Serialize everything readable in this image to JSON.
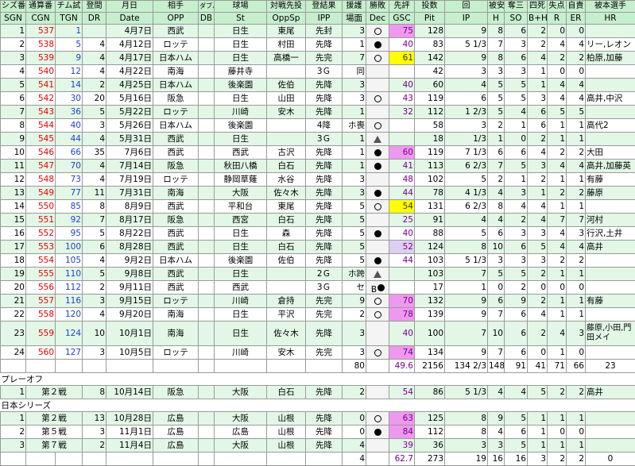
{
  "header_ja": [
    "シズ番",
    "通算番",
    "チム試",
    "登間",
    "月日",
    "相手",
    "ダブル",
    "球場",
    "対戦先投",
    "登結果",
    "援護",
    "勝敗",
    "先評",
    "投数",
    "回",
    "被安",
    "奪三",
    "四死",
    "失点",
    "自責",
    "被本選手"
  ],
  "header_en": [
    "SGN",
    "CGN",
    "TGN",
    "DR",
    "Date",
    "OPP",
    "DB",
    "St",
    "OppSp",
    "IPP",
    "場面",
    "Dec",
    "GSC",
    "Pit",
    "IP",
    "H",
    "SO",
    "B+H",
    "R",
    "ER",
    "HR"
  ],
  "regular_rows": [
    {
      "sgn": "1",
      "cgn": "537",
      "tgn": "1",
      "dr": "",
      "date": "4月7日",
      "opp": "西武",
      "db": "",
      "st": "日生",
      "oppsp": "東尾",
      "ipp": "先封",
      "ba": "3",
      "dec": "lose",
      "gsc": "75",
      "gsc_style": "pk",
      "pit": "128",
      "ip": "9",
      "h": "8",
      "so": "6",
      "bb": "2",
      "r": "0",
      "er": "0",
      "hr": ""
    },
    {
      "sgn": "2",
      "cgn": "538",
      "tgn": "5",
      "dr": "4",
      "date": "4月12日",
      "opp": "ロッテ",
      "db": "",
      "st": "日生",
      "oppsp": "村田",
      "ipp": "先降",
      "ba": "1",
      "dec": "win",
      "gsc": "40",
      "gsc_style": "",
      "pit": "83",
      "ip": "5 1/3",
      "h": "7",
      "so": "3",
      "bb": "2",
      "r": "4",
      "er": "4",
      "hr": "リー,レオン"
    },
    {
      "sgn": "3",
      "cgn": "539",
      "tgn": "9",
      "dr": "4",
      "date": "4月17日",
      "opp": "日本ハム",
      "db": "",
      "st": "日生",
      "oppsp": "高橋一",
      "ipp": "先完",
      "ba": "7",
      "dec": "lose",
      "gsc": "61",
      "gsc_style": "yl",
      "pit": "142",
      "ip": "9",
      "h": "8",
      "so": "6",
      "bb": "4",
      "r": "2",
      "er": "2",
      "hr": "柏原,加藤"
    },
    {
      "sgn": "4",
      "cgn": "540",
      "tgn": "12",
      "dr": "4",
      "date": "4月22日",
      "opp": "南海",
      "db": "",
      "st": "藤井寺",
      "oppsp": "",
      "ipp": "3Ｇ",
      "ba": "同",
      "dec": "",
      "gsc": "",
      "gsc_style": "",
      "pit": "42",
      "ip": "3",
      "h": "3",
      "so": "3",
      "bb": "1",
      "r": "0",
      "er": "0",
      "hr": ""
    },
    {
      "sgn": "5",
      "cgn": "541",
      "tgn": "14",
      "dr": "2",
      "date": "4月25日",
      "opp": "日本ハム",
      "db": "",
      "st": "後楽園",
      "oppsp": "佐伯",
      "ipp": "先降",
      "ba": "3",
      "dec": "",
      "gsc": "40",
      "gsc_style": "",
      "pit": "60",
      "ip": "4",
      "h": "5",
      "so": "5",
      "bb": "1",
      "r": "4",
      "er": "4",
      "hr": ""
    },
    {
      "sgn": "6",
      "cgn": "542",
      "tgn": "30",
      "dr": "20",
      "date": "5月16日",
      "opp": "阪急",
      "db": "",
      "st": "日生",
      "oppsp": "山田",
      "ipp": "先降",
      "ba": "3",
      "dec": "lose",
      "gsc": "43",
      "gsc_style": "",
      "pit": "119",
      "ip": "6",
      "h": "5",
      "so": "5",
      "bb": "3",
      "r": "4",
      "er": "4",
      "hr": "高井,中沢"
    },
    {
      "sgn": "7",
      "cgn": "543",
      "tgn": "36",
      "dr": "5",
      "date": "5月22日",
      "opp": "ロッテ",
      "db": "",
      "st": "川崎",
      "oppsp": "安木",
      "ipp": "先降",
      "ba": "1",
      "dec": "",
      "gsc": "32",
      "gsc_style": "",
      "pit": "112",
      "ip": "1 2/3",
      "h": "5",
      "so": "4",
      "bb": "6",
      "r": "5",
      "er": "5",
      "hr": ""
    },
    {
      "sgn": "8",
      "cgn": "544",
      "tgn": "40",
      "dr": "3",
      "date": "5月26日",
      "opp": "日本ハム",
      "db": "",
      "st": "後楽園",
      "oppsp": "",
      "ipp": "4降",
      "ba": "ホ喪",
      "dec": "lose",
      "gsc": "",
      "gsc_style": "",
      "pit": "58",
      "ip": "3",
      "h": "2",
      "so": "1",
      "bb": "6",
      "r": "1",
      "er": "1",
      "hr": "高代2"
    },
    {
      "sgn": "9",
      "cgn": "545",
      "tgn": "44",
      "dr": "4",
      "date": "5月31日",
      "opp": "西武",
      "db": "",
      "st": "日生",
      "oppsp": "",
      "ipp": "3Ｇ",
      "ba": "1",
      "dec": "tri",
      "gsc": "",
      "gsc_style": "",
      "pit": "18",
      "ip": "1/3",
      "h": "1",
      "so": "0",
      "bb": "2",
      "r": "1",
      "er": "1",
      "hr": ""
    },
    {
      "sgn": "10",
      "cgn": "546",
      "tgn": "66",
      "dr": "35",
      "date": "7月6日",
      "opp": "西武",
      "db": "",
      "st": "西武",
      "oppsp": "古沢",
      "ipp": "先降",
      "ba": "1",
      "dec": "win",
      "gsc": "60",
      "gsc_style": "pk",
      "pit": "119",
      "ip": "7 1/3",
      "h": "6",
      "so": "6",
      "bb": "4",
      "r": "2",
      "er": "2",
      "hr": "大田"
    },
    {
      "sgn": "11",
      "cgn": "547",
      "tgn": "70",
      "dr": "4",
      "date": "7月14日",
      "opp": "阪急",
      "db": "",
      "st": "秋田八橋",
      "oppsp": "白石",
      "ipp": "先降",
      "ba": "1",
      "dec": "win",
      "gsc": "41",
      "gsc_style": "",
      "pit": "113",
      "ip": "6 2/3",
      "h": "7",
      "so": "5",
      "bb": "3",
      "r": "4",
      "er": "4",
      "hr": "高井,加藤英"
    },
    {
      "sgn": "12",
      "cgn": "548",
      "tgn": "73",
      "dr": "4",
      "date": "7月19日",
      "opp": "ロッテ",
      "db": "",
      "st": "静岡草薙",
      "oppsp": "水谷",
      "ipp": "先降",
      "ba": "3",
      "dec": "",
      "gsc": "48",
      "gsc_style": "",
      "pit": "102",
      "ip": "5",
      "h": "2",
      "so": "1",
      "bb": "2",
      "r": "1",
      "er": "1",
      "hr": "有藤"
    },
    {
      "sgn": "13",
      "cgn": "549",
      "tgn": "77",
      "dr": "11",
      "date": "7月31日",
      "opp": "南海",
      "db": "",
      "st": "大阪",
      "oppsp": "佐々木",
      "ipp": "先降",
      "ba": "3",
      "dec": "win",
      "gsc": "44",
      "gsc_style": "",
      "pit": "78",
      "ip": "4 1/3",
      "h": "4",
      "so": "3",
      "bb": "1",
      "r": "2",
      "er": "2",
      "hr": "藤原"
    },
    {
      "sgn": "14",
      "cgn": "550",
      "tgn": "85",
      "dr": "8",
      "date": "8月9日",
      "opp": "西武",
      "db": "",
      "st": "平和台",
      "oppsp": "東尾",
      "ipp": "先降",
      "ba": "5",
      "dec": "lose",
      "gsc": "54",
      "gsc_style": "yl",
      "pit": "131",
      "ip": "6 2/3",
      "h": "8",
      "so": "4",
      "bb": "4",
      "r": "1",
      "er": "1",
      "hr": ""
    },
    {
      "sgn": "15",
      "cgn": "551",
      "tgn": "92",
      "dr": "7",
      "date": "8月17日",
      "opp": "阪急",
      "db": "",
      "st": "西宮",
      "oppsp": "白石",
      "ipp": "先降",
      "ba": "5",
      "dec": "",
      "gsc": "25",
      "gsc_style": "",
      "pit": "91",
      "ip": "4",
      "h": "4",
      "so": "2",
      "bb": "4",
      "r": "7",
      "er": "7",
      "hr": "河村"
    },
    {
      "sgn": "16",
      "cgn": "552",
      "tgn": "95",
      "dr": "5",
      "date": "8月22日",
      "opp": "西武",
      "db": "",
      "st": "日生",
      "oppsp": "森",
      "ipp": "先降",
      "ba": "5",
      "dec": "win",
      "gsc": "40",
      "gsc_style": "",
      "pit": "88",
      "ip": "5",
      "h": "6",
      "so": "3",
      "bb": "3",
      "r": "4",
      "er": "3",
      "hr": "行沢,土井"
    },
    {
      "sgn": "17",
      "cgn": "553",
      "tgn": "100",
      "dr": "6",
      "date": "8月28日",
      "opp": "西武",
      "db": "",
      "st": "日生",
      "oppsp": "白石",
      "ipp": "先降",
      "ba": "5",
      "dec": "",
      "gsc": "52",
      "gsc_style": "lv",
      "pit": "124",
      "ip": "8",
      "h": "10",
      "so": "6",
      "bb": "5",
      "r": "4",
      "er": "4",
      "hr": "高井"
    },
    {
      "sgn": "18",
      "cgn": "554",
      "tgn": "105",
      "dr": "4",
      "date": "9月2日",
      "opp": "日本ハム",
      "db": "",
      "st": "後楽園",
      "oppsp": "佐伯",
      "ipp": "先降",
      "ba": "5",
      "dec": "win",
      "gsc": "44",
      "gsc_style": "",
      "pit": "103",
      "ip": "5 1/3",
      "h": "3",
      "so": "3",
      "bb": "3",
      "r": "2",
      "er": "2",
      "hr": ""
    },
    {
      "sgn": "19",
      "cgn": "555",
      "tgn": "110",
      "dr": "5",
      "date": "9月8日",
      "opp": "西武",
      "db": "",
      "st": "日生",
      "oppsp": "",
      "ipp": "2Ｇ",
      "ba": "ホ跨",
      "dec": "tri",
      "gsc": "",
      "gsc_style": "",
      "pit": "103",
      "ip": "7",
      "h": "5",
      "so": "5",
      "bb": "2",
      "r": "1",
      "er": "1",
      "hr": ""
    },
    {
      "sgn": "20",
      "cgn": "556",
      "tgn": "112",
      "dr": "2",
      "date": "9月11日",
      "opp": "西武",
      "db": "",
      "st": "西武",
      "oppsp": "",
      "ipp": "3Ｇ",
      "ba": "セ",
      "dec": "blk",
      "gsc": "",
      "gsc_style": "",
      "pit": "17",
      "ip": "1",
      "h": "0",
      "so": "2",
      "bb": "0",
      "r": "0",
      "er": "0",
      "hr": ""
    },
    {
      "sgn": "21",
      "cgn": "557",
      "tgn": "116",
      "dr": "3",
      "date": "9月15日",
      "opp": "ロッテ",
      "db": "",
      "st": "川崎",
      "oppsp": "倉持",
      "ipp": "先完",
      "ba": "9",
      "dec": "lose",
      "gsc": "70",
      "gsc_style": "pk",
      "pit": "132",
      "ip": "9",
      "h": "6",
      "so": "9",
      "bb": "2",
      "r": "1",
      "er": "1",
      "hr": "有藤"
    },
    {
      "sgn": "22",
      "cgn": "558",
      "tgn": "120",
      "dr": "4",
      "date": "9月20日",
      "opp": "南海",
      "db": "",
      "st": "日生",
      "oppsp": "平沢",
      "ipp": "先完",
      "ba": "2",
      "dec": "lose",
      "gsc": "78",
      "gsc_style": "pk",
      "pit": "139",
      "ip": "9",
      "h": "7",
      "so": "6",
      "bb": "4",
      "r": "1",
      "er": "1",
      "hr": ""
    },
    {
      "sgn": "23",
      "cgn": "559",
      "tgn": "124",
      "dr": "10",
      "date": "10月1日",
      "opp": "南海",
      "db": "",
      "st": "日生",
      "oppsp": "佐々木",
      "ipp": "先降",
      "ba": "3",
      "dec": "",
      "gsc": "40",
      "gsc_style": "",
      "pit": "100",
      "ip": "7",
      "h": "10",
      "so": "6",
      "bb": "2",
      "r": "4",
      "er": "3",
      "hr": "藤原,小田,門田メイ",
      "tall": true
    },
    {
      "sgn": "24",
      "cgn": "560",
      "tgn": "127",
      "dr": "3",
      "date": "10月5日",
      "opp": "ロッテ",
      "db": "",
      "st": "川崎",
      "oppsp": "安木",
      "ipp": "先完",
      "ba": "3",
      "dec": "lose",
      "gsc": "74",
      "gsc_style": "pk",
      "pit": "134",
      "ip": "9",
      "h": "7",
      "so": "6",
      "bb": "0",
      "r": "1",
      "er": "0",
      "hr": ""
    }
  ],
  "regular_total": {
    "ba": "80",
    "gsc": "49.6",
    "pit": "2156",
    "ip": "134 2/3",
    "h": "148",
    "so": "91",
    "bb": "41",
    "r": "71",
    "er": "66",
    "hr": "23"
  },
  "playoff_title": "プレーオフ",
  "playoff_rows": [
    {
      "sgn": "1",
      "game": "第２戦",
      "dr": "8",
      "date": "10月14日",
      "opp": "阪急",
      "st": "大阪",
      "oppsp": "白石",
      "ipp": "先降",
      "ba": "2",
      "dec": "",
      "gsc": "54",
      "gsc_style": "",
      "pit": "86",
      "ip": "5 1/3",
      "h": "4",
      "so": "4",
      "bb": "5",
      "r": "2",
      "er": "2",
      "hr": "高井"
    }
  ],
  "series_title": "日本シリーズ",
  "series_rows": [
    {
      "sgn": "1",
      "game": "第２戦",
      "dr": "13",
      "date": "10月28日",
      "opp": "広島",
      "st": "大阪",
      "oppsp": "山根",
      "ipp": "先降",
      "ba": "0",
      "dec": "lose",
      "gsc": "63",
      "gsc_style": "pk",
      "pit": "125",
      "ip": "8",
      "h": "9",
      "so": "5",
      "bb": "1",
      "r": "1",
      "er": "1",
      "hr": ""
    },
    {
      "sgn": "2",
      "game": "第５戦",
      "dr": "3",
      "date": "11月1日",
      "opp": "広島",
      "st": "広島",
      "oppsp": "山根",
      "ipp": "先降",
      "ba": "0",
      "dec": "win",
      "gsc": "84",
      "gsc_style": "pk",
      "pit": "112",
      "ip": "8",
      "h": "4",
      "so": "6",
      "bb": "1",
      "r": "0",
      "er": "0",
      "hr": ""
    },
    {
      "sgn": "3",
      "game": "第７戦",
      "dr": "2",
      "date": "11月4日",
      "opp": "広島",
      "st": "大阪",
      "oppsp": "山根",
      "ipp": "先降",
      "ba": "4",
      "dec": "",
      "gsc": "39",
      "gsc_style": "",
      "pit": "36",
      "ip": "3",
      "h": "3",
      "so": "5",
      "bb": "1",
      "r": "1",
      "er": "1",
      "hr": ""
    }
  ],
  "series_total": {
    "ba": "4",
    "gsc": "62.7",
    "pit": "273",
    "ip": "19",
    "h": "16",
    "so": "16",
    "bb": "3",
    "r": "2",
    "er": "2",
    "hr": "0"
  },
  "colors": {
    "header_bg": "#c6efce",
    "row_tint": "#e2f7e6",
    "cgn_red": "#e60000",
    "tgn_blue": "#2040d0",
    "gsc_yellow": "#ffff00",
    "gsc_pink": "#ee99ee",
    "gsc_lavender": "#dcd0f0"
  }
}
